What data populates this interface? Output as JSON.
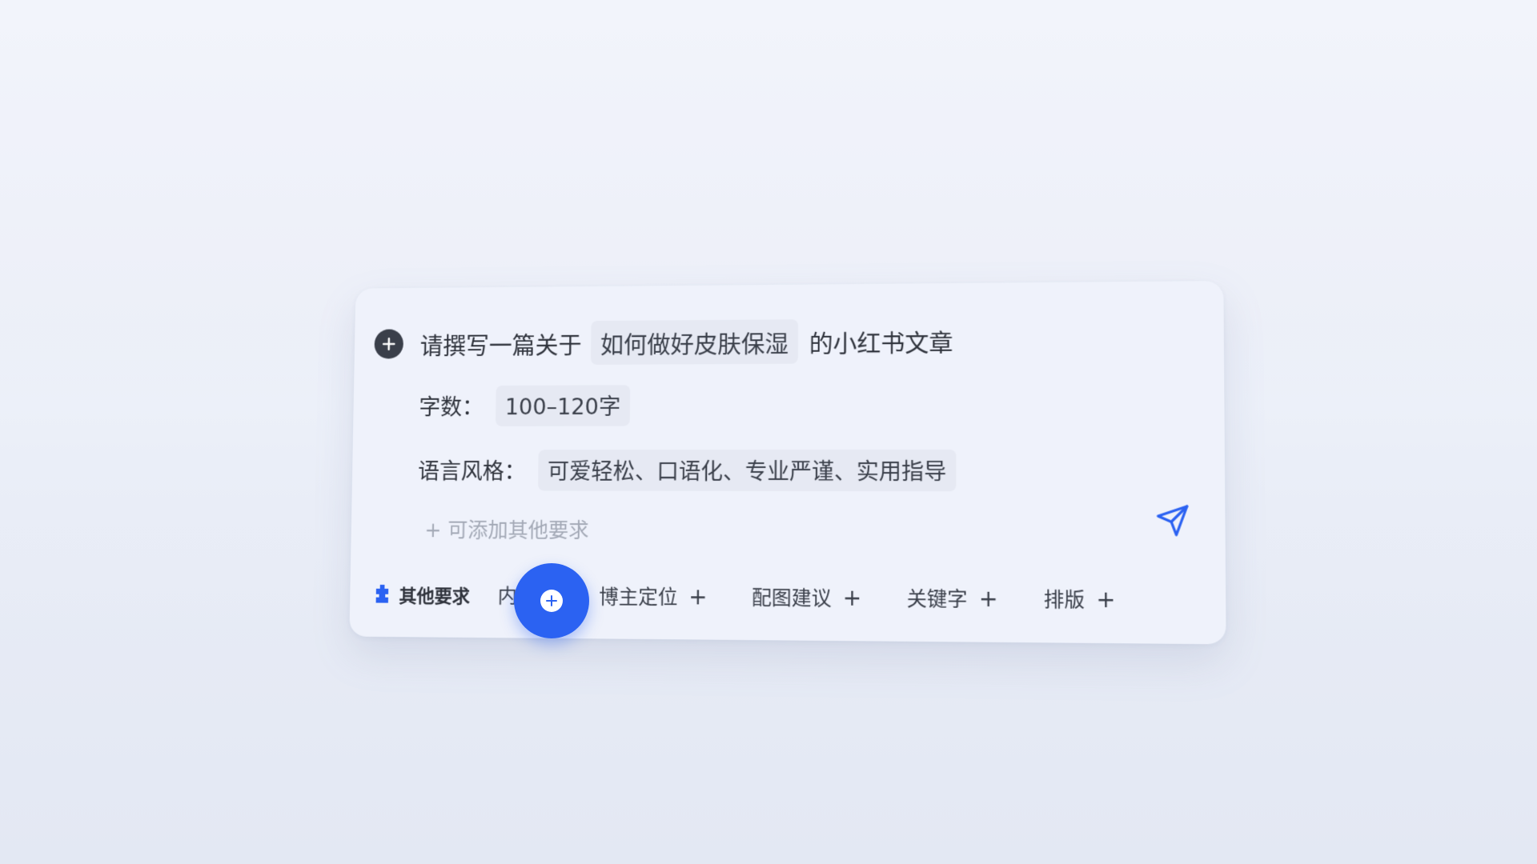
{
  "prompt": {
    "prefix": "请撰写一篇关于",
    "topic": "如何做好皮肤保湿",
    "suffix": "的小红书文章"
  },
  "word_count": {
    "label": "字数：",
    "value": "100–120字"
  },
  "style": {
    "label": "语言风格：",
    "value": "可爱轻松、口语化、专业严谨、实用指导"
  },
  "add_requirement": "+ 可添加其他要求",
  "toolbar": {
    "title": "其他要求",
    "items": [
      {
        "label": "内"
      },
      {
        "label": "博主定位",
        "plus": "+"
      },
      {
        "label": "配图建议",
        "plus": "+"
      },
      {
        "label": "关键字",
        "plus": "+"
      },
      {
        "label": "排版",
        "plus": "+"
      }
    ]
  },
  "colors": {
    "accent": "#2b62f2",
    "dark_icon": "#3a3f4a",
    "chip_bg": "#e6e9f3",
    "placeholder": "#a3a9b6"
  },
  "icons": {
    "add": "plus-circle-icon",
    "send": "send-icon",
    "other": "puzzle-icon",
    "cursor": "pointer-cursor-icon"
  }
}
